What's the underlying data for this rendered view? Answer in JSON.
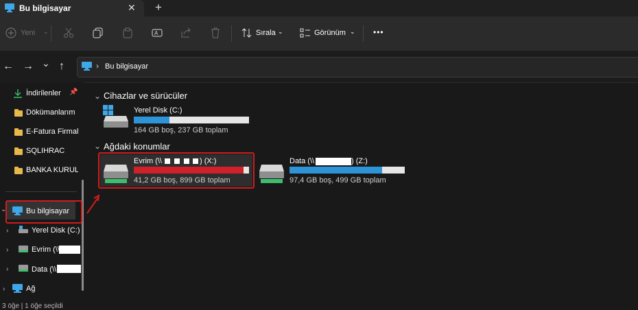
{
  "tab": {
    "title": "Bu bilgisayar",
    "close": "✕",
    "new": "+"
  },
  "toolbar": {
    "new_label": "Yeni",
    "sort_label": "Sırala",
    "view_label": "Görünüm",
    "more": "•••"
  },
  "address": {
    "path": "Bu bilgisayar",
    "sep": "›"
  },
  "nav": {
    "back": "←",
    "forward": "→",
    "recent": "⌄",
    "up": "↑"
  },
  "sidebar": {
    "quick": [
      {
        "label": "İndirilenler"
      },
      {
        "label": "Dökümanlarım"
      },
      {
        "label": "E-Fatura Firmala"
      },
      {
        "label": "SQLIHRAC"
      },
      {
        "label": "BANKA KURULU"
      }
    ],
    "this_pc": "Bu bilgisayar",
    "drives": [
      {
        "label": "Yerel Disk (C:)"
      },
      {
        "label": "Evrim (\\\\"
      },
      {
        "label": "Data (\\\\"
      }
    ],
    "network": "Ağ"
  },
  "content": {
    "devices_header": "Cihazlar ve sürücüler",
    "network_header": "Ağdaki konumlar",
    "drives": [
      {
        "name": "Yerel Disk (C:)",
        "sub": "164 GB boş, 237 GB toplam",
        "used_fraction": 0.31,
        "color": "#2e94d8"
      },
      {
        "name_prefix": "Evrim (\\\\",
        "name_suffix": ") (X:)",
        "sub": "41,2 GB boş, 899 GB toplam",
        "used_fraction": 0.954,
        "color": "#d0202a"
      },
      {
        "name_prefix": "Data (\\\\",
        "name_suffix": ") (Z:)",
        "sub": "97,4 GB boş, 499 GB toplam",
        "used_fraction": 0.805,
        "color": "#2e94d8"
      }
    ]
  },
  "status": {
    "text": "3 öğe  |  1 öğe seçildi"
  }
}
